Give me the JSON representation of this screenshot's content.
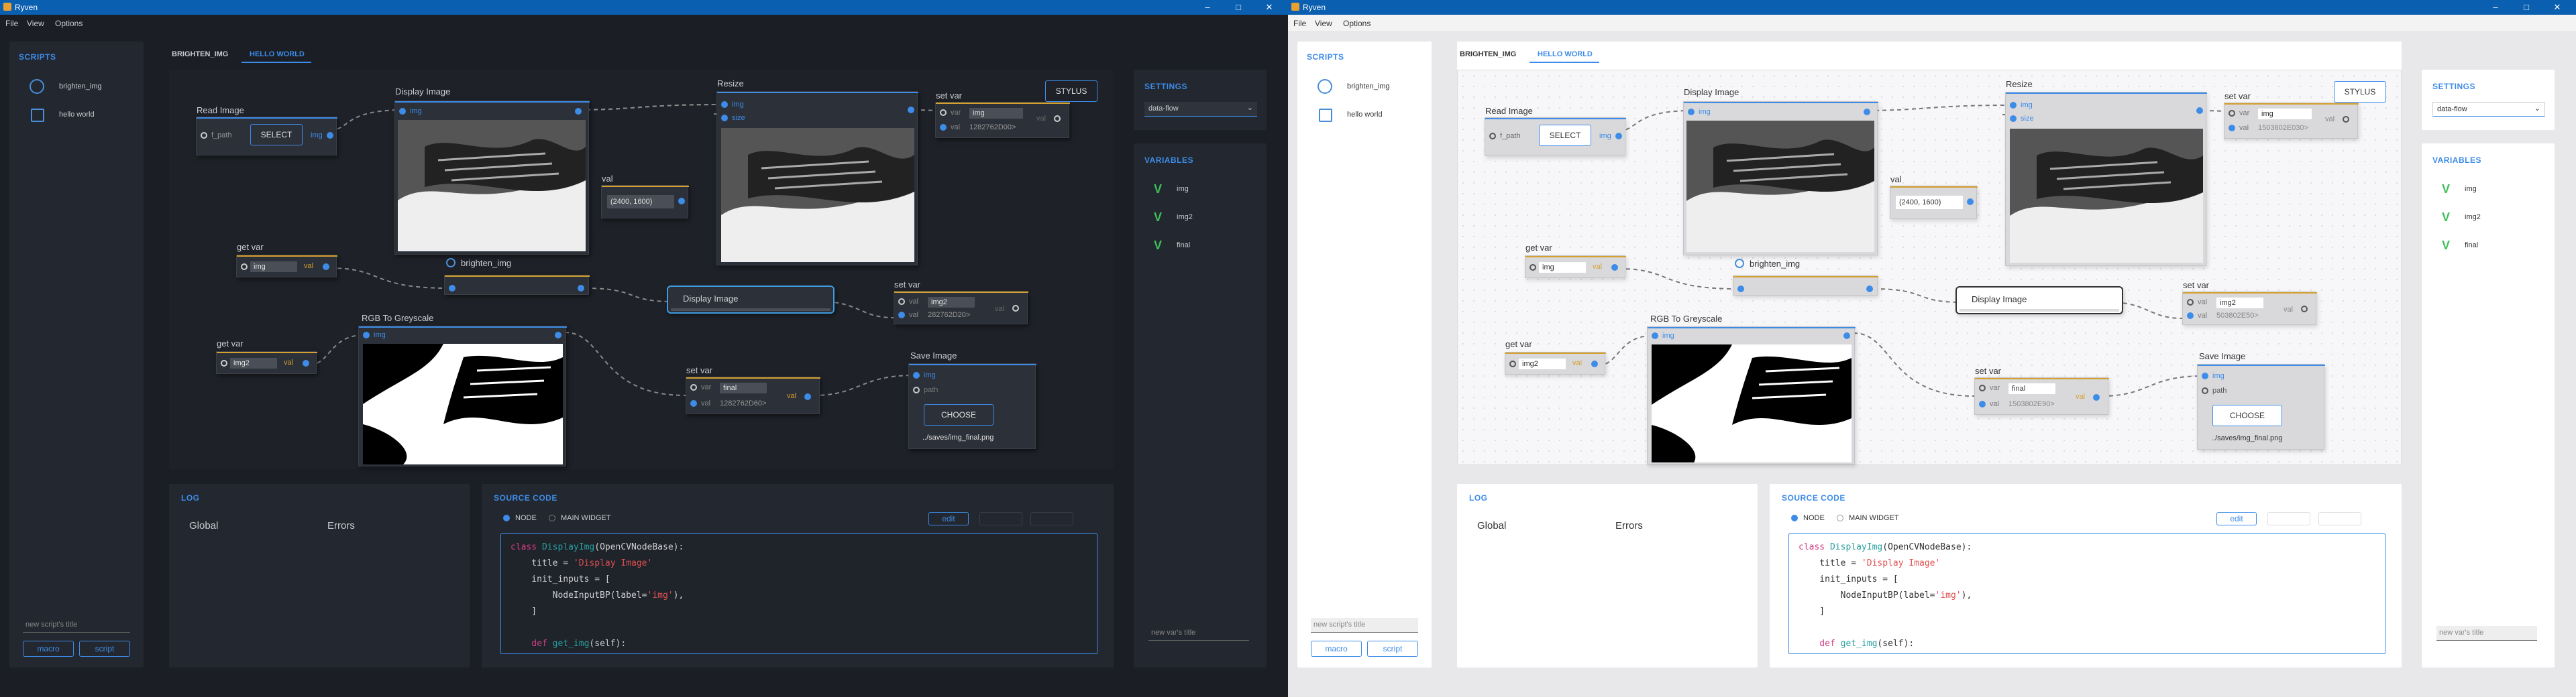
{
  "app": {
    "title": "Ryven"
  },
  "window_controls": [
    "–",
    "□",
    "✕"
  ],
  "menu": [
    "File",
    "View",
    "Options"
  ],
  "scripts_panel": {
    "title": "SCRIPTS",
    "items": [
      {
        "icon": "gear-icon",
        "label": "brighten_img"
      },
      {
        "icon": "edit-icon",
        "label": "hello world"
      }
    ],
    "new_title_placeholder": "new script's title",
    "macro_button": "macro",
    "script_button": "script"
  },
  "tabs": [
    "BRIGHTEN_IMG",
    "HELLO WORLD"
  ],
  "active_tab": 1,
  "stylus_button": "STYLUS",
  "nodes": {
    "read_image": {
      "title": "Read Image",
      "port_in": "f_path",
      "select": "SELECT",
      "port_out": "img"
    },
    "display1": {
      "title": "Display Image",
      "port_in": "img"
    },
    "val": {
      "title": "val",
      "value": "(2400, 1600)"
    },
    "resize": {
      "title": "Resize",
      "port_img": "img",
      "port_size": "size"
    },
    "setvar1": {
      "title": "set var",
      "port_var": "var",
      "var_value": "img",
      "port_val": "val",
      "val_value_dark": "1282762D00>",
      "val_value_light": "1503802E030>",
      "out_label": "val"
    },
    "getvar1": {
      "title": "get var",
      "var_value": "img",
      "out_label": "val"
    },
    "brighten": {
      "title": "brighten_img"
    },
    "display2": {
      "title": "Display Image"
    },
    "setvar2": {
      "title": "set var",
      "port_var": "val",
      "var_value": "img2",
      "port_val": "val",
      "val_value_dark": "282762D20>",
      "val_value_light": "503802E50>",
      "out_label": "val"
    },
    "rgb": {
      "title": "RGB To Greyscale",
      "port_in": "img"
    },
    "getvar2": {
      "title": "get var",
      "var_value": "img2",
      "out_label": "val"
    },
    "setvar3": {
      "title": "set var",
      "port_var": "var",
      "var_value": "final",
      "port_val": "val",
      "val_value_dark": "1282762D60>",
      "val_value_light": "1503802E90>",
      "out_label": "val"
    },
    "save": {
      "title": "Save Image",
      "port_img": "img",
      "port_path": "path",
      "choose": "CHOOSE",
      "file": "../saves/img_final.png"
    }
  },
  "settings_panel": {
    "title": "SETTINGS",
    "select_value": "data-flow"
  },
  "variables_panel": {
    "title": "VARIABLES",
    "items": [
      "img",
      "img2",
      "final"
    ],
    "new_var_placeholder": "new var's title"
  },
  "log_panel": {
    "title": "LOG",
    "tabs": [
      "Global",
      "Errors"
    ]
  },
  "source_panel": {
    "title": "SOURCE CODE",
    "radio_node": "NODE",
    "radio_widget": "MAIN WIDGET",
    "edit_button": "edit",
    "code": {
      "l1_kw": "class ",
      "l1_cls": "DisplayImg",
      "l1_rest": "(OpenCVNodeBase):",
      "l2_a": "    title = ",
      "l2_str": "'Display Image'",
      "l3": "    init_inputs = [",
      "l4_a": "        NodeInputBP(label=",
      "l4_str": "'img'",
      "l4_b": "),",
      "l5": "    ]",
      "l7_kw": "    def ",
      "l7_cls": "get_img",
      "l7_rest": "(self):"
    }
  },
  "colors": {
    "accent": "#3d8ce8",
    "dark_bg": "#1b1e24",
    "light_bg": "#e8e8ea",
    "titlebar": "#0a5fb0",
    "var_green": "#3ec05a",
    "gold": "#d4a030"
  }
}
